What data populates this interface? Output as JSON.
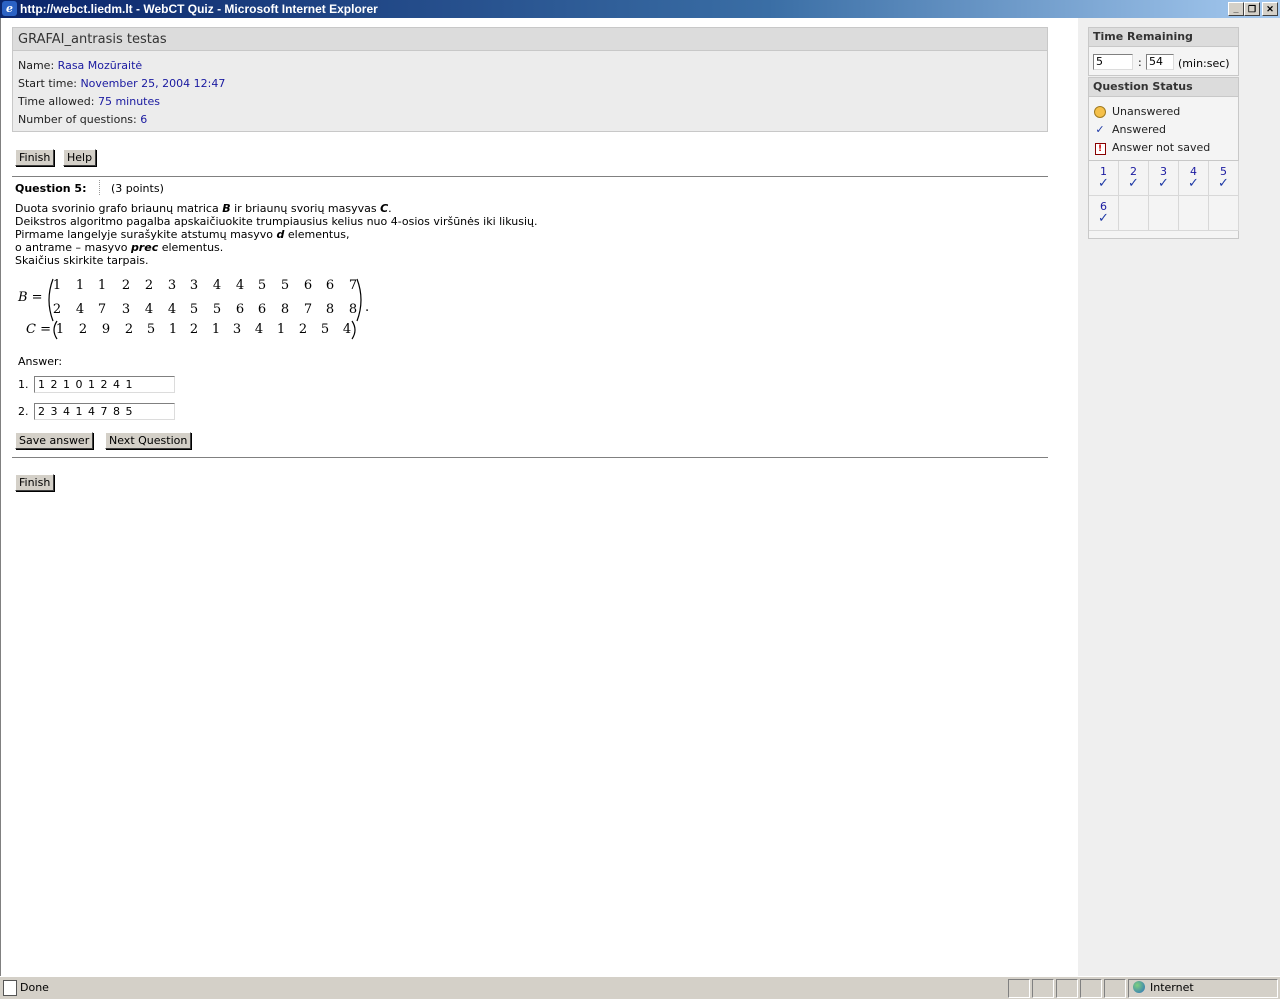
{
  "window": {
    "title": "http://webct.liedm.lt - WebCT Quiz - Microsoft Internet Explorer",
    "minimize": "_",
    "restore": "❐",
    "close": "✕"
  },
  "quiz": {
    "title": "GRAFAI_antrasis testas",
    "name_label": "Name:",
    "name_value": "Rasa Mozūraitė",
    "start_label": "Start time:",
    "start_value": "November 25, 2004 12:47",
    "allowed_label": "Time allowed:",
    "allowed_value": "75 minutes",
    "count_label": "Number of questions:",
    "count_value": "6"
  },
  "buttons": {
    "finish": "Finish",
    "help": "Help",
    "save_answer": "Save answer",
    "next_question": "Next Question"
  },
  "question": {
    "heading": "Question 5:",
    "points": "(3 points)",
    "line1_a": "Duota svorinio grafo briaunų matrica ",
    "line1_b": "B",
    "line1_c": " ir briaunų svorių masyvas ",
    "line1_d": "C",
    "line1_e": ".",
    "line2": "Deikstros algoritmo pagalba apskaičiuokite trumpiausius kelius nuo 4-osios viršūnės iki likusių.",
    "line3_a": "Pirmame langelyje surašykite atstumų masyvo ",
    "line3_b": "d",
    "line3_c": " elementus,",
    "line4_a": "o antrame – masyvo ",
    "line4_b": "prec",
    "line4_c": " elementus.",
    "line5": "Skaičius skirkite tarpais.",
    "matrix_B_label": "B =",
    "matrix_B_row1": [
      "1",
      "1",
      "1",
      "2",
      "2",
      "3",
      "3",
      "4",
      "4",
      "5",
      "5",
      "6",
      "6",
      "7"
    ],
    "matrix_B_row2": [
      "2",
      "4",
      "7",
      "3",
      "4",
      "4",
      "5",
      "5",
      "6",
      "6",
      "8",
      "7",
      "8",
      "8"
    ],
    "matrix_C_label": "C =",
    "matrix_C_row": [
      "1",
      "2",
      "9",
      "2",
      "5",
      "1",
      "2",
      "1",
      "3",
      "4",
      "1",
      "2",
      "5",
      "4"
    ],
    "matrix_B_end": "."
  },
  "answer": {
    "label": "Answer:",
    "field1_num": "1.",
    "field1_value": "1 2 1 0 1 2 4 1",
    "field2_num": "2.",
    "field2_value": "2 3 4 1 4 7 8 5"
  },
  "timer": {
    "heading": "Time Remaining",
    "minutes": "5",
    "colon": ":",
    "seconds": "54",
    "unit": "(min:sec)"
  },
  "status": {
    "heading": "Question Status",
    "unanswered": "Unanswered",
    "answered": "Answered",
    "not_saved": "Answer not saved",
    "questions": [
      {
        "num": "1",
        "state": "answered"
      },
      {
        "num": "2",
        "state": "answered"
      },
      {
        "num": "3",
        "state": "answered"
      },
      {
        "num": "4",
        "state": "answered"
      },
      {
        "num": "5",
        "state": "answered"
      },
      {
        "num": "6",
        "state": "answered"
      }
    ]
  },
  "statusbar": {
    "done": "Done",
    "zone": "Internet"
  },
  "colors": {
    "titlebar": "#0a246a",
    "link_value": "#1a1aa0",
    "check": "#1f3aa6"
  }
}
